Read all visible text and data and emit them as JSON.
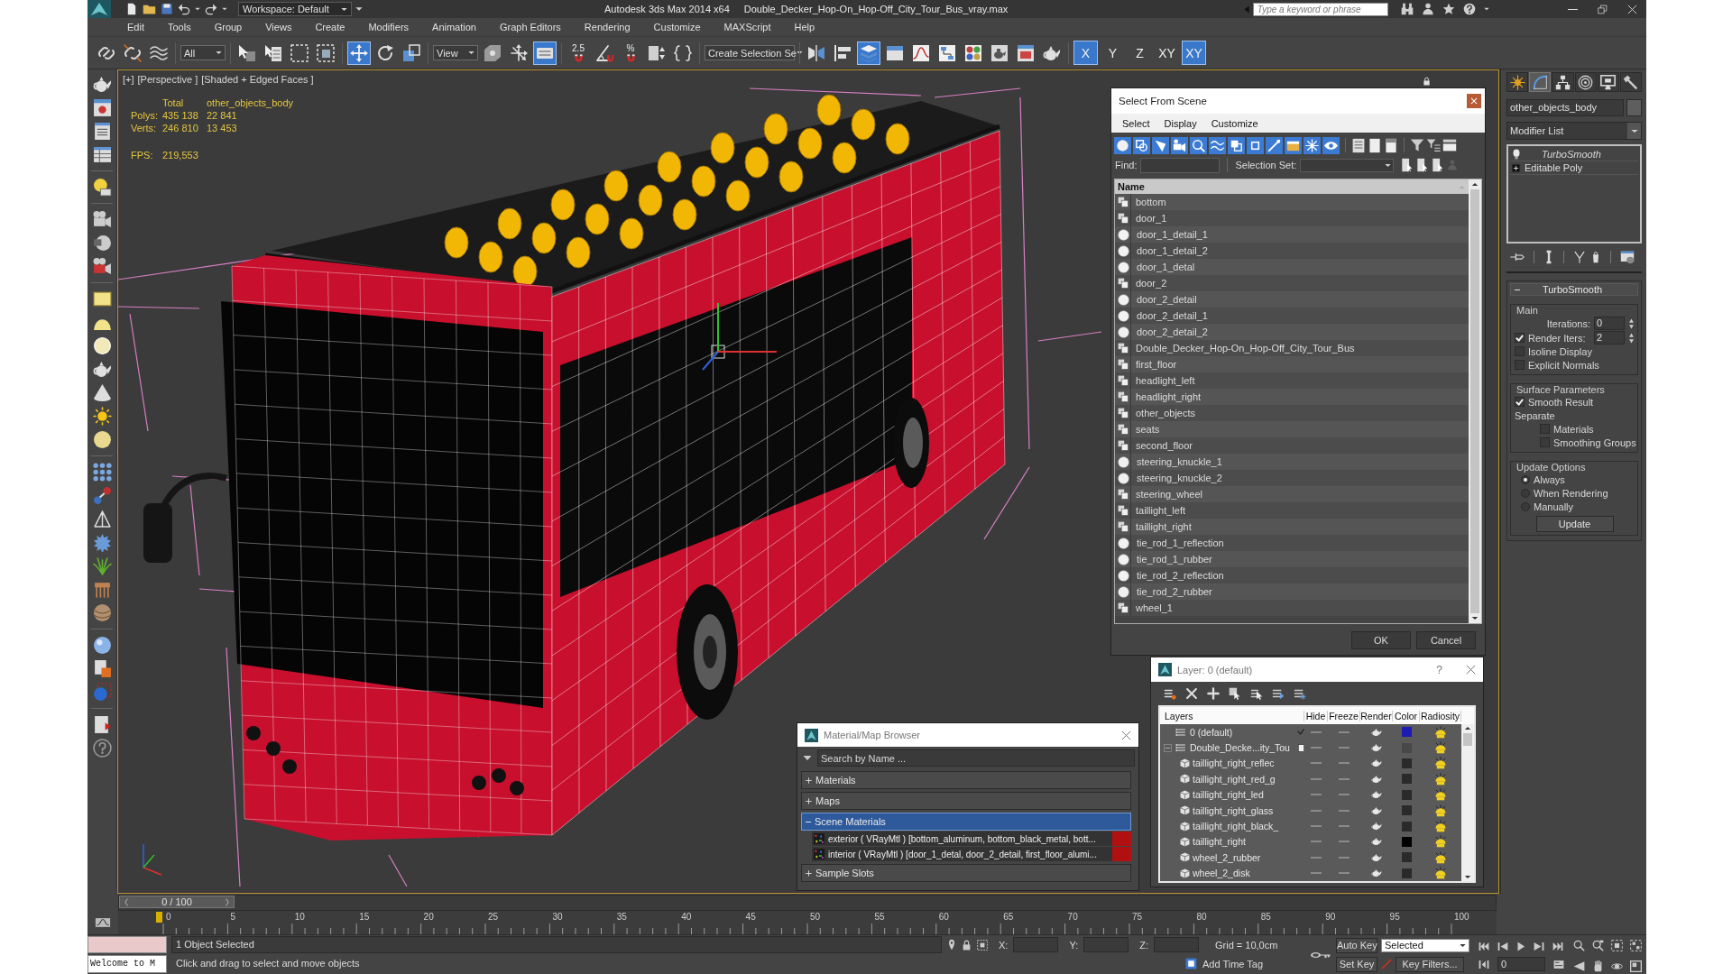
{
  "title_bar": {
    "workspace": "Workspace: Default",
    "app_title": "Autodesk 3ds Max 2014 x64",
    "file_name": "Double_Decker_Hop-On_Hop-Off_City_Tour_Bus_vray.max",
    "search": {
      "placeholder": "Type a keyword or phrase"
    }
  },
  "menu": [
    "Edit",
    "Tools",
    "Group",
    "Views",
    "Create",
    "Modifiers",
    "Animation",
    "Graph Editors",
    "Rendering",
    "Customize",
    "MAXScript",
    "Help"
  ],
  "main_toolbar": [
    {
      "kind": "tool",
      "selected": false
    },
    {
      "kind": "tool",
      "selected": false
    },
    {
      "kind": "tool",
      "selected": false
    },
    {
      "kind": "dropdown",
      "value": "All"
    },
    {
      "kind": "tool",
      "selected": false
    },
    {
      "kind": "tool",
      "selected": false
    },
    {
      "kind": "tool",
      "selected": false
    },
    {
      "kind": "tool",
      "selected": false
    },
    {
      "kind": "tool",
      "selected": true
    },
    {
      "kind": "tool",
      "selected": false
    },
    {
      "kind": "tool",
      "selected": false
    },
    {
      "kind": "dropdown",
      "value": "View"
    },
    {
      "kind": "tool",
      "selected": false
    },
    {
      "kind": "tool",
      "selected": false
    },
    {
      "kind": "tool",
      "selected": true
    },
    {
      "kind": "snap",
      "label": "2.5",
      "selected": false
    },
    {
      "kind": "tool",
      "selected": false
    },
    {
      "kind": "snap",
      "label": "%",
      "selected": false
    },
    {
      "kind": "tool",
      "selected": false
    },
    {
      "kind": "tool",
      "selected": false
    },
    {
      "kind": "dropdown",
      "value": "Create Selection Se"
    },
    {
      "kind": "tool",
      "selected": false
    },
    {
      "kind": "tool",
      "selected": false
    },
    {
      "kind": "tool",
      "selected": true
    },
    {
      "kind": "tool",
      "selected": false
    },
    {
      "kind": "tool",
      "selected": false
    },
    {
      "kind": "tool",
      "selected": false
    },
    {
      "kind": "tool",
      "selected": false
    },
    {
      "kind": "tool",
      "selected": false
    },
    {
      "kind": "tool",
      "selected": false
    },
    {
      "kind": "tool",
      "selected": false
    },
    {
      "kind": "axis",
      "label": "X",
      "selected": true
    },
    {
      "kind": "axis",
      "label": "Y",
      "selected": false
    },
    {
      "kind": "axis",
      "label": "Z",
      "selected": false
    },
    {
      "kind": "axis",
      "label": "XY",
      "selected": false
    },
    {
      "kind": "axis",
      "label": "XY",
      "selected": true
    }
  ],
  "viewport": {
    "label_menus": [
      "[+]",
      "[Perspective ]",
      "[Shaded + Edged Faces ]"
    ],
    "stats": {
      "columns": [
        "Total",
        "other_objects_body"
      ],
      "rows": [
        {
          "label": "Polys:",
          "values": [
            "435 138",
            "22 841"
          ]
        },
        {
          "label": "Verts:",
          "values": [
            "246 810",
            "13 453"
          ]
        }
      ],
      "fps_label": "FPS:",
      "fps": "219,553"
    }
  },
  "select_from_scene": {
    "title": "Select From Scene",
    "menus": [
      "Select",
      "Display",
      "Customize"
    ],
    "find_label": "Find:",
    "selection_set_label": "Selection Set:",
    "column": "Name",
    "objects": [
      {
        "name": "bottom",
        "kind": "group"
      },
      {
        "name": "door_1",
        "kind": "group"
      },
      {
        "name": "door_1_detail_1",
        "kind": "geometry"
      },
      {
        "name": "door_1_detail_2",
        "kind": "geometry"
      },
      {
        "name": "door_1_detal",
        "kind": "geometry"
      },
      {
        "name": "door_2",
        "kind": "group"
      },
      {
        "name": "door_2_detail",
        "kind": "geometry"
      },
      {
        "name": "door_2_detail_1",
        "kind": "geometry"
      },
      {
        "name": "door_2_detail_2",
        "kind": "geometry"
      },
      {
        "name": "Double_Decker_Hop-On_Hop-Off_City_Tour_Bus",
        "kind": "group"
      },
      {
        "name": "first_floor",
        "kind": "group"
      },
      {
        "name": "headlight_left",
        "kind": "group"
      },
      {
        "name": "headlight_right",
        "kind": "group"
      },
      {
        "name": "other_objects",
        "kind": "group"
      },
      {
        "name": "seats",
        "kind": "group"
      },
      {
        "name": "second_floor",
        "kind": "group"
      },
      {
        "name": "steering_knuckle_1",
        "kind": "geometry"
      },
      {
        "name": "steering_knuckle_2",
        "kind": "geometry"
      },
      {
        "name": "steering_wheel",
        "kind": "group"
      },
      {
        "name": "taillight_left",
        "kind": "group"
      },
      {
        "name": "taillight_right",
        "kind": "group"
      },
      {
        "name": "tie_rod_1_reflection",
        "kind": "geometry"
      },
      {
        "name": "tie_rod_1_rubber",
        "kind": "geometry"
      },
      {
        "name": "tie_rod_2_reflection",
        "kind": "geometry"
      },
      {
        "name": "tie_rod_2_rubber",
        "kind": "geometry"
      },
      {
        "name": "wheel_1",
        "kind": "group"
      }
    ],
    "buttons": [
      "OK",
      "Cancel"
    ]
  },
  "command_panel": {
    "tabs": [
      {
        "selected": false
      },
      {
        "selected": true
      },
      {
        "selected": false
      },
      {
        "selected": false
      },
      {
        "selected": false
      },
      {
        "selected": false
      }
    ],
    "object_name": "other_objects_body",
    "modifier_list": "Modifier List",
    "stack": [
      {
        "name": "TurboSmooth",
        "kind": "modifier"
      },
      {
        "name": "Editable Poly",
        "kind": "base"
      }
    ],
    "rollout": {
      "title": "TurboSmooth",
      "expanded": true,
      "groups": [
        {
          "title": "Main",
          "controls": [
            {
              "kind": "spinner",
              "label": "Iterations:",
              "value": "0"
            },
            {
              "kind": "check_spinner",
              "label": "Render Iters:",
              "checked": true,
              "value": "2"
            },
            {
              "kind": "checkbox",
              "label": "Isoline Display",
              "checked": false
            },
            {
              "kind": "checkbox",
              "label": "Explicit Normals",
              "checked": false
            }
          ]
        },
        {
          "title": "Surface Parameters",
          "controls": [
            {
              "kind": "checkbox",
              "label": "Smooth Result",
              "checked": true
            },
            {
              "kind": "label",
              "label": "Separate"
            },
            {
              "kind": "sub_checkbox",
              "label": "Materials",
              "checked": false
            },
            {
              "kind": "sub_checkbox",
              "label": "Smoothing Groups",
              "checked": false
            }
          ]
        },
        {
          "title": "Update Options",
          "controls": [
            {
              "kind": "radio",
              "label": "Always",
              "selected": true
            },
            {
              "kind": "radio",
              "label": "When Rendering",
              "selected": false
            },
            {
              "kind": "radio",
              "label": "Manually",
              "selected": false
            },
            {
              "kind": "button",
              "label": "Update"
            }
          ]
        }
      ]
    }
  },
  "material_browser": {
    "title": "Material/Map Browser",
    "search": {
      "placeholder": "Search by Name ..."
    },
    "groups": [
      {
        "name": "Materials",
        "expanded": false,
        "selected": false
      },
      {
        "name": "Maps",
        "expanded": false,
        "selected": false
      },
      {
        "name": "Scene Materials",
        "expanded": true,
        "selected": true,
        "items": [
          "exterior ( VRayMtl ) [bottom_aluminum, bottom_black_metal, bott...",
          "interior ( VRayMtl ) [door_1_detal, door_2_detail, first_floor_alumi..."
        ]
      },
      {
        "name": "Sample Slots",
        "expanded": false,
        "selected": false
      }
    ]
  },
  "layer_manager": {
    "title": "Layer: 0 (default)",
    "help": "?",
    "columns": [
      "Layers",
      "Hide",
      "Freeze",
      "Render",
      "Color",
      "Radiosity"
    ],
    "layers": [
      {
        "name": "0 (default)",
        "current": true,
        "color": "#1c1cb4"
      },
      {
        "name": "Double_Decke...ity_Tou",
        "current": false,
        "expanded": true,
        "color": "#484848",
        "children": [
          {
            "name": "taillight_right_reflec",
            "color": "#2a2a2a"
          },
          {
            "name": "taillight_right_red_g",
            "color": "#2a2a2a"
          },
          {
            "name": "taillight_right_led",
            "color": "#2a2a2a"
          },
          {
            "name": "taillight_right_glass",
            "color": "#2a2a2a"
          },
          {
            "name": "taillight_right_black_",
            "color": "#2a2a2a"
          },
          {
            "name": "taillight_right",
            "color": "#000000"
          },
          {
            "name": "wheel_2_rubber",
            "color": "#2a2a2a"
          },
          {
            "name": "wheel_2_disk",
            "color": "#2a2a2a"
          }
        ]
      }
    ]
  },
  "time_slider": {
    "label": "0 / 100",
    "level": 0
  },
  "ruler": [
    "0",
    "5",
    "10",
    "15",
    "20",
    "25",
    "30",
    "35",
    "40",
    "45",
    "50",
    "55",
    "60",
    "65",
    "70",
    "75",
    "80",
    "85",
    "90",
    "95",
    "100"
  ],
  "status_bar": {
    "listener": "Welcome to M",
    "selection": "1 Object Selected",
    "prompt": "Click and drag to select and move objects",
    "coords": [
      "X:",
      "Y:",
      "Z:"
    ],
    "grid": "Grid = 10,0cm",
    "add_time_tag": "Add Time Tag",
    "auto_key": "Auto Key",
    "key_mode": "Selected",
    "set_key": "Set Key",
    "key_filters": "Key Filters...",
    "frame": "0"
  }
}
